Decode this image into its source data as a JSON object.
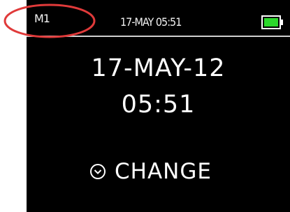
{
  "status_bar": {
    "channel": "M1",
    "datetime": "17-MAY 05:51",
    "battery_level": 1.0
  },
  "main": {
    "date": "17-MAY-12",
    "time": "05:51"
  },
  "action": {
    "label": "CHANGE",
    "icon": "down-circle-icon"
  },
  "colors": {
    "battery_fill": "#2bd82b",
    "annotation": "#e03a3a",
    "screen_background": "#000000"
  }
}
